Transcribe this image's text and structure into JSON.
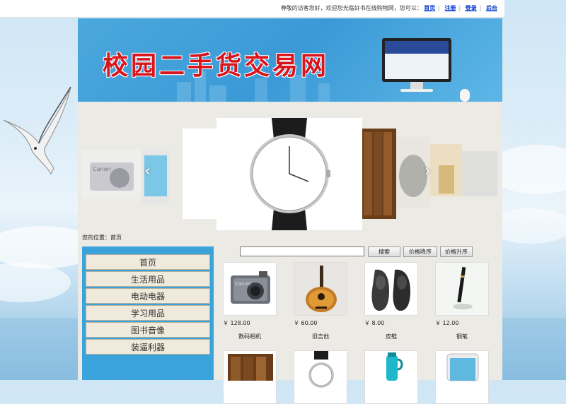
{
  "topbar": {
    "welcome_text": "尊敬的访客您好，欢迎您光临好书在线购物网，您可以：",
    "links": [
      "首页",
      "注册",
      "登录",
      "后台"
    ]
  },
  "banner": {
    "title": "校园二手货交易网"
  },
  "breadcrumb": {
    "label": "您的位置：",
    "current": "首页"
  },
  "categories": [
    "首页",
    "生活用品",
    "电动电器",
    "学习用品",
    "图书音像",
    "装逼利器"
  ],
  "search": {
    "value": "",
    "button": "搜索"
  },
  "sort_buttons": [
    "价格降序",
    "价格升序"
  ],
  "products": [
    {
      "name": "数码相机",
      "price": "￥ 128.00",
      "icon": "camera-icon"
    },
    {
      "name": "旧吉他",
      "price": "￥ 60.00",
      "icon": "guitar-icon"
    },
    {
      "name": "皮鞋",
      "price": "￥ 8.00",
      "icon": "shoes-icon"
    },
    {
      "name": "钢笔",
      "price": "￥ 12.00",
      "icon": "pen-icon"
    }
  ],
  "products_row2": [
    {
      "icon": "books-icon"
    },
    {
      "icon": "watch-icon"
    },
    {
      "icon": "thermos-icon"
    },
    {
      "icon": "phone-icon"
    }
  ],
  "slider": {
    "arrow_left": "‹",
    "arrow_right": "›"
  },
  "colors": {
    "title_red": "#d8141c",
    "banner_blue": "#3b9ad6",
    "sidebar_blue": "#3aa3dc",
    "link_blue": "#0033cc"
  }
}
